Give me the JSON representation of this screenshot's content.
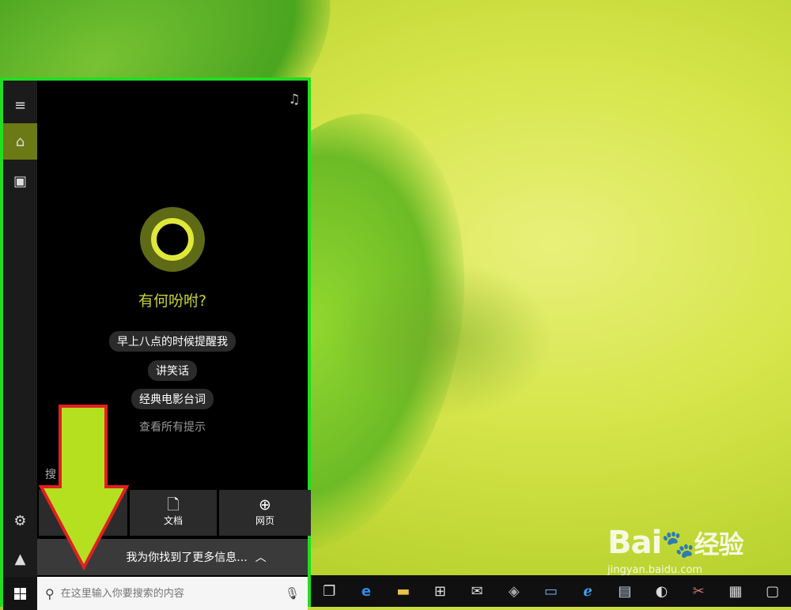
{
  "cortana": {
    "greeting": "有何吩咐?",
    "suggestions": [
      "早上八点的时候提醒我",
      "讲笑话",
      "经典电影台词"
    ],
    "see_all": "查看所有提示",
    "search_caption": "搜",
    "categories": [
      {
        "label": "",
        "icon": "apps-icon"
      },
      {
        "label": "文档",
        "icon": "document-icon"
      },
      {
        "label": "网页",
        "icon": "globe-icon"
      }
    ],
    "more_info": "我为你找到了更多信息...",
    "search_placeholder": "在这里输入你要搜索的内容"
  },
  "rail": {
    "items": [
      "hamburger-menu-icon",
      "home-icon",
      "notebook-icon",
      "settings-icon",
      "feedback-icon"
    ]
  },
  "taskbar": {
    "apps": [
      "task-view-icon",
      "edge-icon",
      "file-explorer-icon",
      "store-icon",
      "mail-icon",
      "app-icon",
      "network-icon",
      "ie-icon",
      "notepad-icon",
      "paint-icon",
      "tools-icon",
      "calculator-icon",
      "window-icon"
    ]
  },
  "watermark": {
    "brand_latin": "Bai",
    "brand_cn": "经验",
    "url": "jingyan.baidu.com"
  },
  "colors": {
    "panel_border": "#22dd22",
    "accent": "#c6d233",
    "arrow_fill": "#b5e01f",
    "arrow_stroke": "#e02020"
  }
}
